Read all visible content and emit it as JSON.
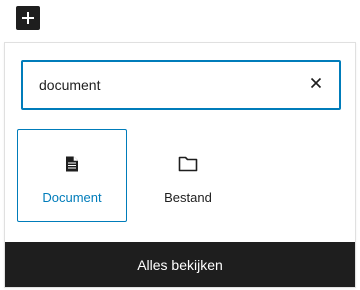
{
  "inserter": {
    "toggle_icon": "plus-icon"
  },
  "search": {
    "value": "document",
    "placeholder": "",
    "clear_icon": "close-icon"
  },
  "results": [
    {
      "label": "Document",
      "icon": "document-icon",
      "selected": true
    },
    {
      "label": "Bestand",
      "icon": "folder-icon",
      "selected": false
    }
  ],
  "footer": {
    "browse_all_label": "Alles bekijken"
  },
  "colors": {
    "accent": "#007cba",
    "dark": "#1e1e1e",
    "border": "#e0e0e0",
    "background": "#ffffff"
  }
}
